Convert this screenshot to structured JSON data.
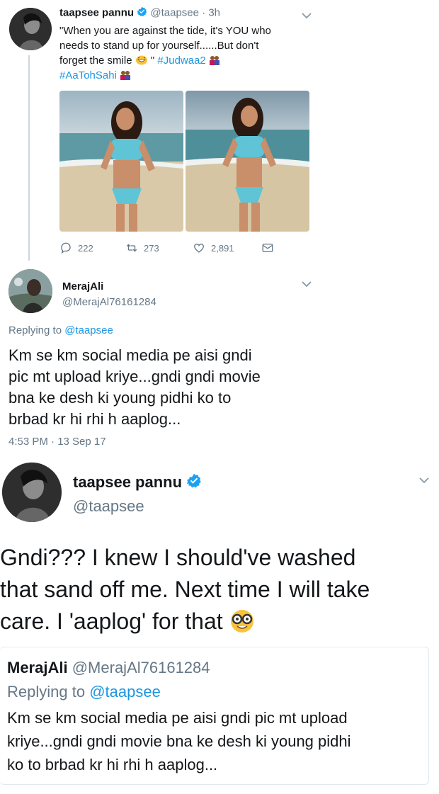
{
  "tweet1": {
    "name": "taapsee pannu",
    "handle": "@taapsee",
    "time": "· 3h",
    "lines": [
      "\"When you are against the tide, it's YOU who",
      "needs to stand up for yourself......But don't",
      "forget the smile"
    ],
    "line3_suffix": "\"",
    "hashtag1": "#Judwaa2",
    "hashtag2": "#AaToHSahi",
    "hashtag2_text": "#AaTohSahi",
    "actions": {
      "replies": "222",
      "retweets": "273",
      "likes": "2,891"
    }
  },
  "reply1": {
    "name": "MerajAli",
    "handle": "@MerajAl76161284",
    "replying_prefix": "Replying to ",
    "replying_handle": "@taapsee",
    "lines": [
      "Km se km social media pe aisi gndi",
      "pic mt upload kriye...gndi gndi movie",
      "bna ke desh ki young pidhi ko to",
      "brbad kr hi rhi h aaplog..."
    ],
    "timestamp": "4:53 PM · 13 Sep 17"
  },
  "tweet2": {
    "name": "taapsee pannu",
    "handle": "@taapsee",
    "lines": [
      "Gndi??? I knew I should've washed",
      "that sand off me. Next time I will take",
      "care. I 'aaplog' for that"
    ]
  },
  "quoted": {
    "name": "MerajAli",
    "handle": "@MerajAl76161284",
    "replying_prefix": "Replying to ",
    "replying_handle": "@taapsee",
    "lines": [
      "Km se km social media pe aisi gndi pic mt upload",
      "kriye...gndi gndi movie bna ke desh ki young pidhi",
      "ko to brbad kr hi rhi h aaplog..."
    ]
  },
  "colors": {
    "link": "#1b95e0",
    "muted": "#657786",
    "verified": "#1da1f2"
  }
}
